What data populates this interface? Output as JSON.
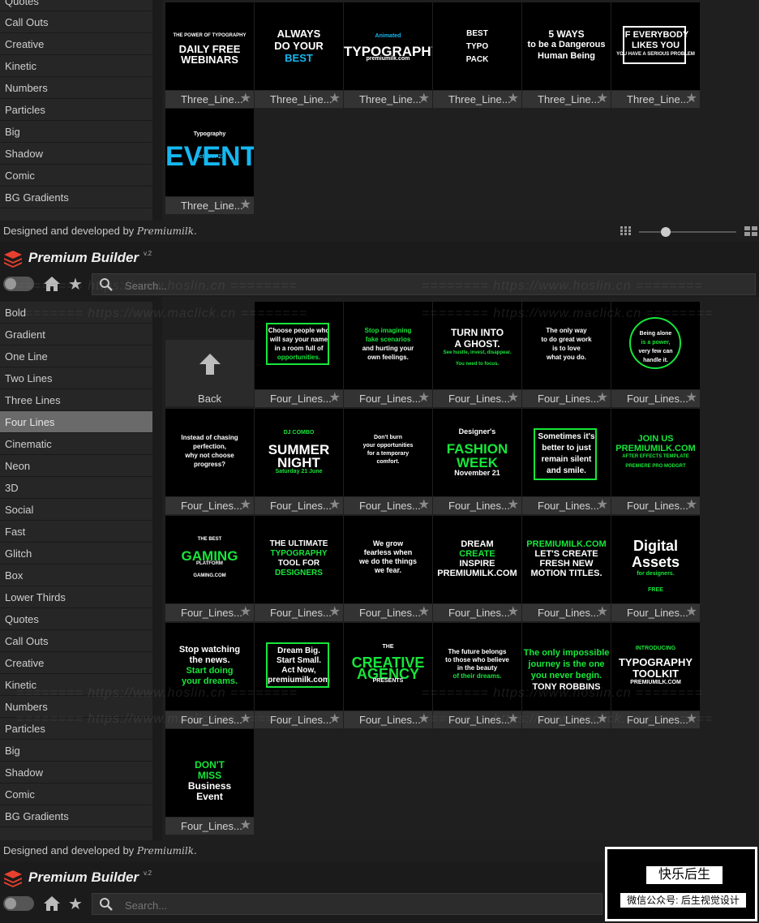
{
  "colors": {
    "accent_green": "#17e63a",
    "accent_blue": "#16b7f0",
    "active_item": "#6a6a6a"
  },
  "top_sidebar": [
    "Quotes",
    "Call Outs",
    "Creative",
    "Kinetic",
    "Numbers",
    "Particles",
    "Big",
    "Shadow",
    "Comic",
    "BG Gradients"
  ],
  "top_tiles": [
    {
      "caption": "Three_Line...",
      "lines": [
        "THE POWER OF TYPOGRAPHY",
        "DAILY FREE",
        "WEBINARS"
      ]
    },
    {
      "caption": "Three_Line...",
      "lines": [
        "ALWAYS",
        "DO YOUR",
        "BEST"
      ]
    },
    {
      "caption": "Three_Line...",
      "lines": [
        "Animated",
        "TYPOGRAPHY",
        "premiumilk.com"
      ]
    },
    {
      "caption": "Three_Line...",
      "lines": [
        "BEST",
        "TYPO",
        "PACK"
      ]
    },
    {
      "caption": "Three_Line...",
      "lines": [
        "5 WAYS",
        "to be a Dangerous",
        "Human Being"
      ]
    },
    {
      "caption": "Three_Line...",
      "lines": [
        "IF EVERYBODY",
        "LIKES YOU",
        "YOU HAVE A SERIOUS PROBLEM"
      ]
    },
    {
      "caption": "Three_Line...",
      "lines": [
        "Typography",
        "EVENT",
        "October 21"
      ]
    }
  ],
  "footer": {
    "prefix": "Designed and developed by",
    "brand": "Premiumilk."
  },
  "header": {
    "title": "Premium Builder",
    "version": "v.2"
  },
  "search": {
    "placeholder": "Search..."
  },
  "sidebar": [
    "Bold",
    "Gradient",
    "One Line",
    "Two Lines",
    "Three Lines",
    "Four Lines",
    "Cinematic",
    "Neon",
    "3D",
    "Social",
    "Fast",
    "Glitch",
    "Box",
    "Lower Thirds",
    "Quotes",
    "Call Outs",
    "Creative",
    "Kinetic",
    "Numbers",
    "Particles",
    "Big",
    "Shadow",
    "Comic",
    "BG Gradients"
  ],
  "active_item": "Four Lines",
  "back_label": "Back",
  "tiles": [
    {
      "caption": "Four_Lines...",
      "lines": [
        "Choose people who",
        "will say your name",
        "in a room full of",
        "opportunities."
      ]
    },
    {
      "caption": "Four_Lines...",
      "lines": [
        "Stop imagining",
        "fake scenarios",
        "and hurting your",
        "own feelings."
      ]
    },
    {
      "caption": "Four_Lines...",
      "lines": [
        "TURN INTO",
        "A GHOST.",
        "See hustle, invest, disappear.",
        "You need to focus."
      ]
    },
    {
      "caption": "Four_Lines...",
      "lines": [
        "The only way",
        "to do great work",
        "is to love",
        "what you do."
      ]
    },
    {
      "caption": "Four_Lines...",
      "lines": [
        "Being alone",
        "is a power,",
        "very few can",
        "handle it."
      ]
    },
    {
      "caption": "Four_Lines...",
      "lines": [
        "Instead of chasing",
        "perfection,",
        "why not choose",
        "progress?"
      ]
    },
    {
      "caption": "Four_Lines...",
      "lines": [
        "DJ COMBO",
        "SUMMER",
        "NIGHT",
        "Saturday 21 June"
      ]
    },
    {
      "caption": "Four_Lines...",
      "lines": [
        "Don't burn",
        "your opportunities",
        "for a temporary",
        "comfort."
      ]
    },
    {
      "caption": "Four_Lines...",
      "lines": [
        "Designer's",
        "FASHION",
        "WEEK",
        "November 21"
      ]
    },
    {
      "caption": "Four_Lines...",
      "lines": [
        "Sometimes it's",
        "better to just",
        "remain silent",
        "and smile."
      ]
    },
    {
      "caption": "Four_Lines...",
      "lines": [
        "JOIN US",
        "PREMIUMILK.COM",
        "AFTER EFFECTS TEMPLATE",
        "PREMIERE PRO MODGRT"
      ]
    },
    {
      "caption": "Four_Lines...",
      "lines": [
        "THE BEST",
        "GAMING",
        "PLATFORM",
        "GAMING.COM"
      ]
    },
    {
      "caption": "Four_Lines...",
      "lines": [
        "THE ULTIMATE",
        "TYPOGRAPHY",
        "TOOL FOR",
        "DESIGNERS"
      ]
    },
    {
      "caption": "Four_Lines...",
      "lines": [
        "We grow",
        "fearless when",
        "we do the things",
        "we fear."
      ]
    },
    {
      "caption": "Four_Lines...",
      "lines": [
        "DREAM",
        "CREATE",
        "INSPIRE",
        "PREMIUMILK.COM"
      ]
    },
    {
      "caption": "Four_Lines...",
      "lines": [
        "PREMIUMILK.COM",
        "LET'S CREATE",
        "FRESH NEW",
        "MOTION TITLES."
      ]
    },
    {
      "caption": "Four_Lines...",
      "lines": [
        "Digital",
        "Assets",
        "for designers.",
        "FREE"
      ]
    },
    {
      "caption": "Four_Lines...",
      "lines": [
        "Stop watching",
        "the news.",
        "Start doing",
        "your dreams."
      ]
    },
    {
      "caption": "Four_Lines...",
      "lines": [
        "Dream Big.",
        "Start Small.",
        "Act Now,",
        "premiumilk.com"
      ]
    },
    {
      "caption": "Four_Lines...",
      "lines": [
        "THE",
        "CREATIVE",
        "AGENCY",
        "PRESENTS"
      ]
    },
    {
      "caption": "Four_Lines...",
      "lines": [
        "The future belongs",
        "to those who believe",
        "in the beauty",
        "of their dreams."
      ]
    },
    {
      "caption": "Four_Lines...",
      "lines": [
        "The only impossible",
        "journey is the one",
        "you never begin.",
        "TONY ROBBINS"
      ]
    },
    {
      "caption": "Four_Lines...",
      "lines": [
        "INTRODUCING",
        "TYPOGRAPHY",
        "TOOLKIT",
        "PREMIUMILK.COM"
      ]
    },
    {
      "caption": "Four_Lines...",
      "lines": [
        "DON'T",
        "MISS",
        "Business",
        "Event"
      ]
    }
  ],
  "footer2": {
    "prefix": "Designed and developed by",
    "brand": "Premiumilk."
  },
  "header2": {
    "title": "Premium Builder",
    "version": "v.2"
  },
  "search2": {
    "placeholder": "Search..."
  },
  "watermarks": [
    "======== https://www.hoslin.cn ========",
    "======== https://www.maclick.cn ========"
  ],
  "wechat": {
    "title": "快乐后生",
    "subtitle": "微信公众号: 后生视觉设计"
  }
}
